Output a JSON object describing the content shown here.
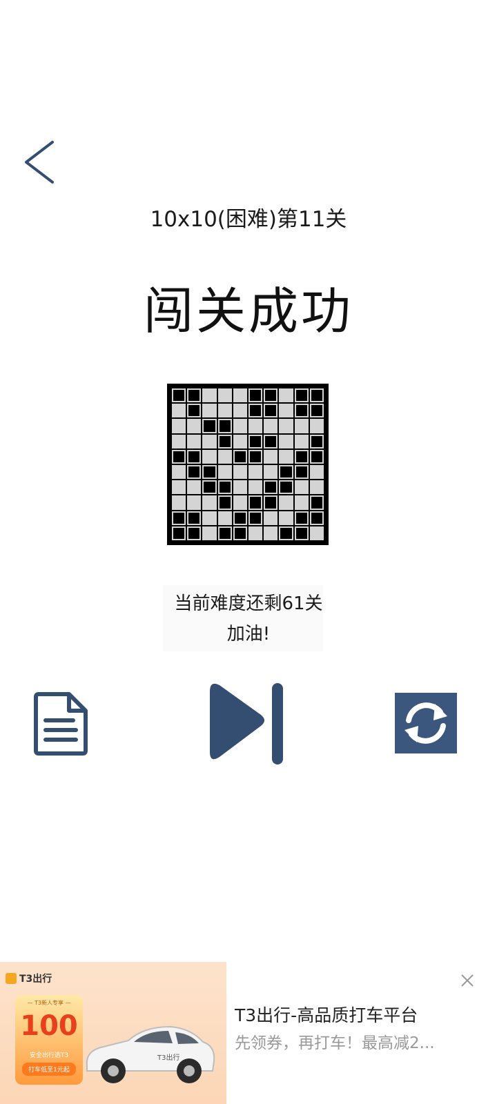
{
  "header": {
    "back_icon": "chevron-left-icon",
    "level_title": "10x10(困难)第11关",
    "success_text": "闯关成功"
  },
  "board": {
    "size": 10,
    "rows": [
      [
        1,
        1,
        0,
        0,
        0,
        1,
        1,
        0,
        1,
        1
      ],
      [
        0,
        1,
        0,
        0,
        0,
        1,
        1,
        0,
        1,
        1
      ],
      [
        0,
        0,
        1,
        1,
        0,
        0,
        0,
        0,
        0,
        0
      ],
      [
        0,
        0,
        0,
        1,
        0,
        1,
        1,
        0,
        0,
        1
      ],
      [
        1,
        1,
        0,
        0,
        1,
        1,
        0,
        0,
        1,
        1
      ],
      [
        0,
        1,
        1,
        0,
        0,
        0,
        0,
        1,
        1,
        0
      ],
      [
        0,
        0,
        1,
        1,
        0,
        0,
        1,
        1,
        0,
        0
      ],
      [
        0,
        0,
        0,
        1,
        0,
        1,
        1,
        0,
        0,
        1
      ],
      [
        1,
        1,
        0,
        0,
        1,
        1,
        0,
        0,
        1,
        1
      ],
      [
        1,
        1,
        0,
        1,
        1,
        0,
        0,
        1,
        1,
        0
      ]
    ]
  },
  "status": {
    "remaining_text": "当前难度还剩61关",
    "cheer_text": "加油!"
  },
  "actions": {
    "document_icon": "document-icon",
    "next_icon": "skip-next-icon",
    "restart_icon": "refresh-icon",
    "accent_color": "#344e72",
    "restart_bg": "#3c577d"
  },
  "ad": {
    "brand": "T3出行",
    "coupon_tag": "— T3新人专享 —",
    "coupon_amount": "100",
    "coupon_foot1": "安全出行选T3",
    "coupon_foot2": "打车低至1元起",
    "car_badge": "T3出行",
    "title": "T3出行-高品质打车平台",
    "description": "先领券，再打车！最高减2...",
    "close_icon": "close-icon"
  }
}
